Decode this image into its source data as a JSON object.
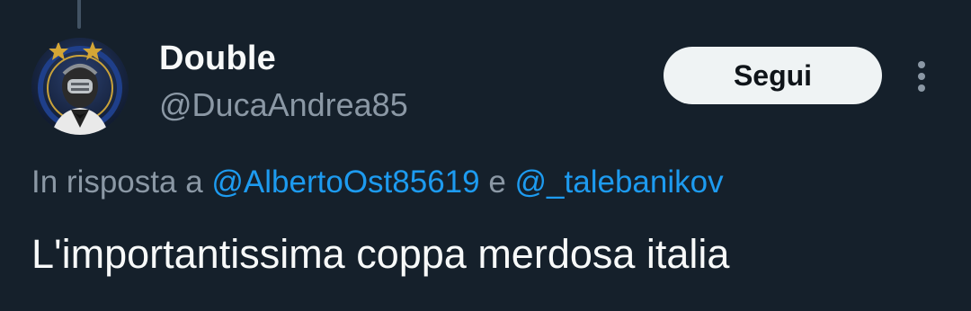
{
  "tweet": {
    "author": {
      "display_name": "Double",
      "handle": "@DucaAndrea85",
      "avatar_icon": "avatar-icon"
    },
    "follow_label": "Segui",
    "more_icon": "more-vertical-icon",
    "reply": {
      "prefix": "In risposta a",
      "mention1": "@AlbertoOst85619",
      "conjunction": "e",
      "mention2": "@_talebanikov"
    },
    "text": "L'importantissima coppa merdosa italia"
  },
  "colors": {
    "background": "#15202b",
    "secondary_text": "#8b98a5",
    "link": "#1d9bf0",
    "button_bg": "#eff3f4"
  }
}
